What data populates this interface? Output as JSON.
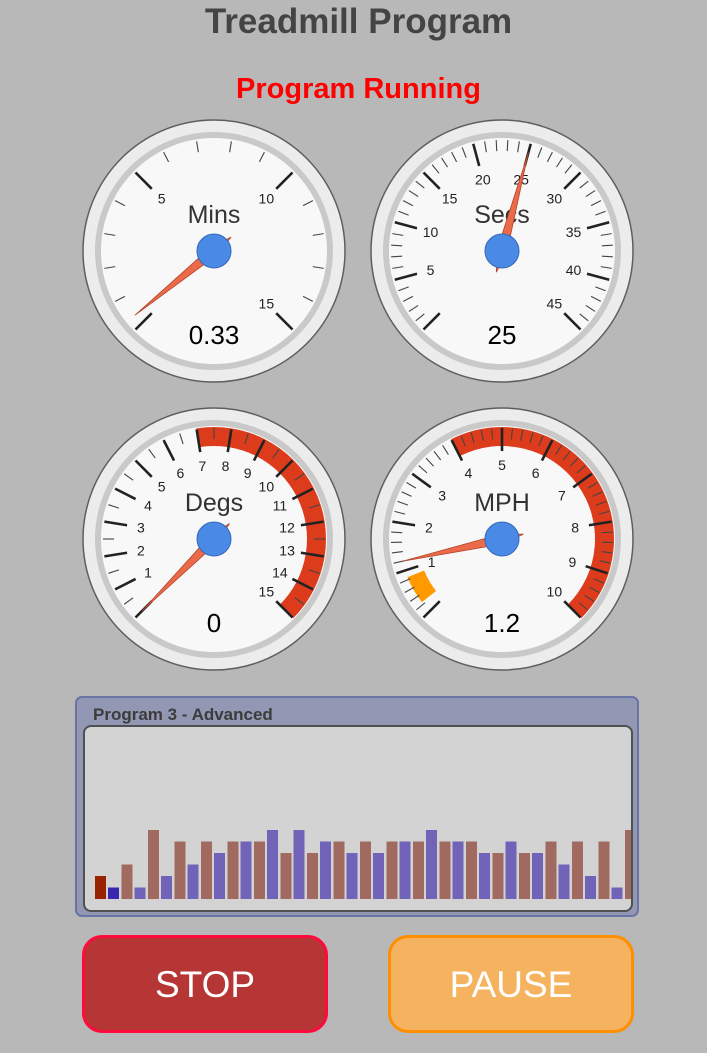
{
  "app": {
    "title": "Treadmill Program",
    "status": "Program Running"
  },
  "colors": {
    "background": "#b8b8b8",
    "status": "#ff0000",
    "needle": "#ea6a4a",
    "hub": "#4a8ae6",
    "zone": "#dd3c1c",
    "marker": "#ff9900",
    "bar_speed": "#a06a60",
    "bar_incline": "#7063b8",
    "bar_done": "#992200",
    "bar_done_incline": "#3a27b0"
  },
  "gauges": {
    "mins": {
      "label": "Mins",
      "value_text": "0.33",
      "value": 0.33,
      "min": 0,
      "max": 15,
      "major_step": 5,
      "minor_count": 4,
      "tick_labels": [
        "5",
        "10",
        "15"
      ],
      "show_zero_label": false
    },
    "secs": {
      "label": "Secs",
      "value_text": "25",
      "value": 25,
      "min": 0,
      "max": 45,
      "major_step": 5,
      "minor_count": 4,
      "tick_labels": [
        "5",
        "10",
        "15",
        "20",
        "25",
        "30",
        "35",
        "40",
        "45"
      ],
      "show_zero_label": false
    },
    "degs": {
      "label": "Degs",
      "value_text": "0",
      "value": 0,
      "min": 0,
      "max": 15,
      "major_step": 1,
      "minor_count": 1,
      "tick_labels": [
        "1",
        "2",
        "3",
        "4",
        "5",
        "6",
        "7",
        "8",
        "9",
        "10",
        "11",
        "12",
        "13",
        "14",
        "15"
      ],
      "show_zero_label": false,
      "zone": [
        7,
        15
      ]
    },
    "mph": {
      "label": "MPH",
      "value_text": "1.2",
      "value": 1.2,
      "min": 0,
      "max": 10,
      "major_step": 1,
      "minor_count": 4,
      "tick_labels": [
        "1",
        "2",
        "3",
        "4",
        "5",
        "6",
        "7",
        "8",
        "9",
        "10"
      ],
      "show_zero_label": false,
      "zone": [
        4,
        10
      ],
      "marker": [
        0.25,
        0.85
      ]
    }
  },
  "program": {
    "title": "Program 3 - Advanced",
    "max_level": 12,
    "completed_segments": 1,
    "speed_levels": [
      2,
      3,
      6,
      5,
      5,
      5,
      5,
      4,
      4,
      5,
      5,
      5,
      5,
      5,
      5,
      4,
      4,
      5,
      5,
      5,
      6,
      3,
      2
    ],
    "incline_levels": [
      1,
      1,
      2,
      3,
      4,
      5,
      6,
      6,
      5,
      4,
      4,
      5,
      6,
      5,
      4,
      5,
      4,
      3,
      2,
      1,
      1
    ]
  },
  "buttons": {
    "stop": "STOP",
    "pause": "PAUSE"
  }
}
